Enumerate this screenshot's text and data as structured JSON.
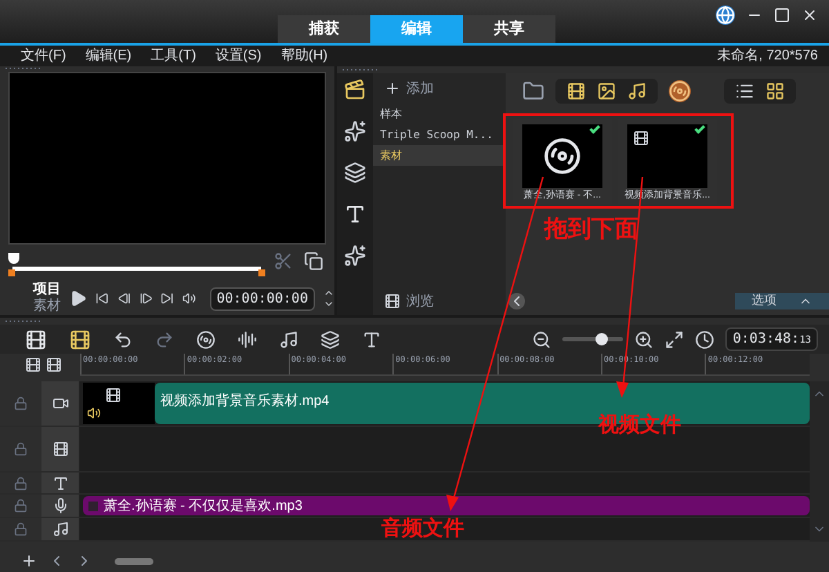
{
  "tabs": [
    {
      "label": "捕获",
      "selected": false
    },
    {
      "label": "编辑",
      "selected": true
    },
    {
      "label": "共享",
      "selected": false
    }
  ],
  "menu": [
    "文件(F)",
    "编辑(E)",
    "工具(T)",
    "设置(S)",
    "帮助(H)"
  ],
  "project_info": "未命名, 720*576",
  "preview": {
    "modes": [
      {
        "label": "项目",
        "selected": true
      },
      {
        "label": "素材",
        "selected": false
      }
    ],
    "timecode": "00:00:00:00"
  },
  "library": {
    "add": "添加",
    "folders": [
      {
        "label": "样本",
        "selected": false
      },
      {
        "label": "Triple Scoop M...",
        "selected": false
      },
      {
        "label": "素材",
        "selected": true
      }
    ],
    "media": [
      {
        "kind": "audio",
        "caption": "萧全,孙语赛 - 不...",
        "checked": true
      },
      {
        "kind": "video",
        "caption": "视频添加背景音乐...",
        "checked": true
      }
    ],
    "browse": "浏览",
    "options": "选项"
  },
  "timeline": {
    "timecode": "0:03:48:",
    "frames": "13",
    "zoom": {
      "level": 0.65
    },
    "ruler": [
      "00:00:00:00",
      "00:00:02:00",
      "00:00:04:00",
      "00:00:06:00",
      "00:00:08:00",
      "00:00:10:00",
      "00:00:12:00"
    ],
    "tracks": [
      {
        "kind": "video",
        "clip": "视频添加背景音乐素材.mp4"
      },
      {
        "kind": "overlay"
      },
      {
        "kind": "title"
      },
      {
        "kind": "voice",
        "clip": "萧全.孙语赛 - 不仅仅是喜欢.mp3"
      },
      {
        "kind": "music"
      }
    ]
  },
  "annotations": {
    "drag_hint": "拖到下面",
    "video_label": "视频文件",
    "audio_label": "音频文件"
  }
}
